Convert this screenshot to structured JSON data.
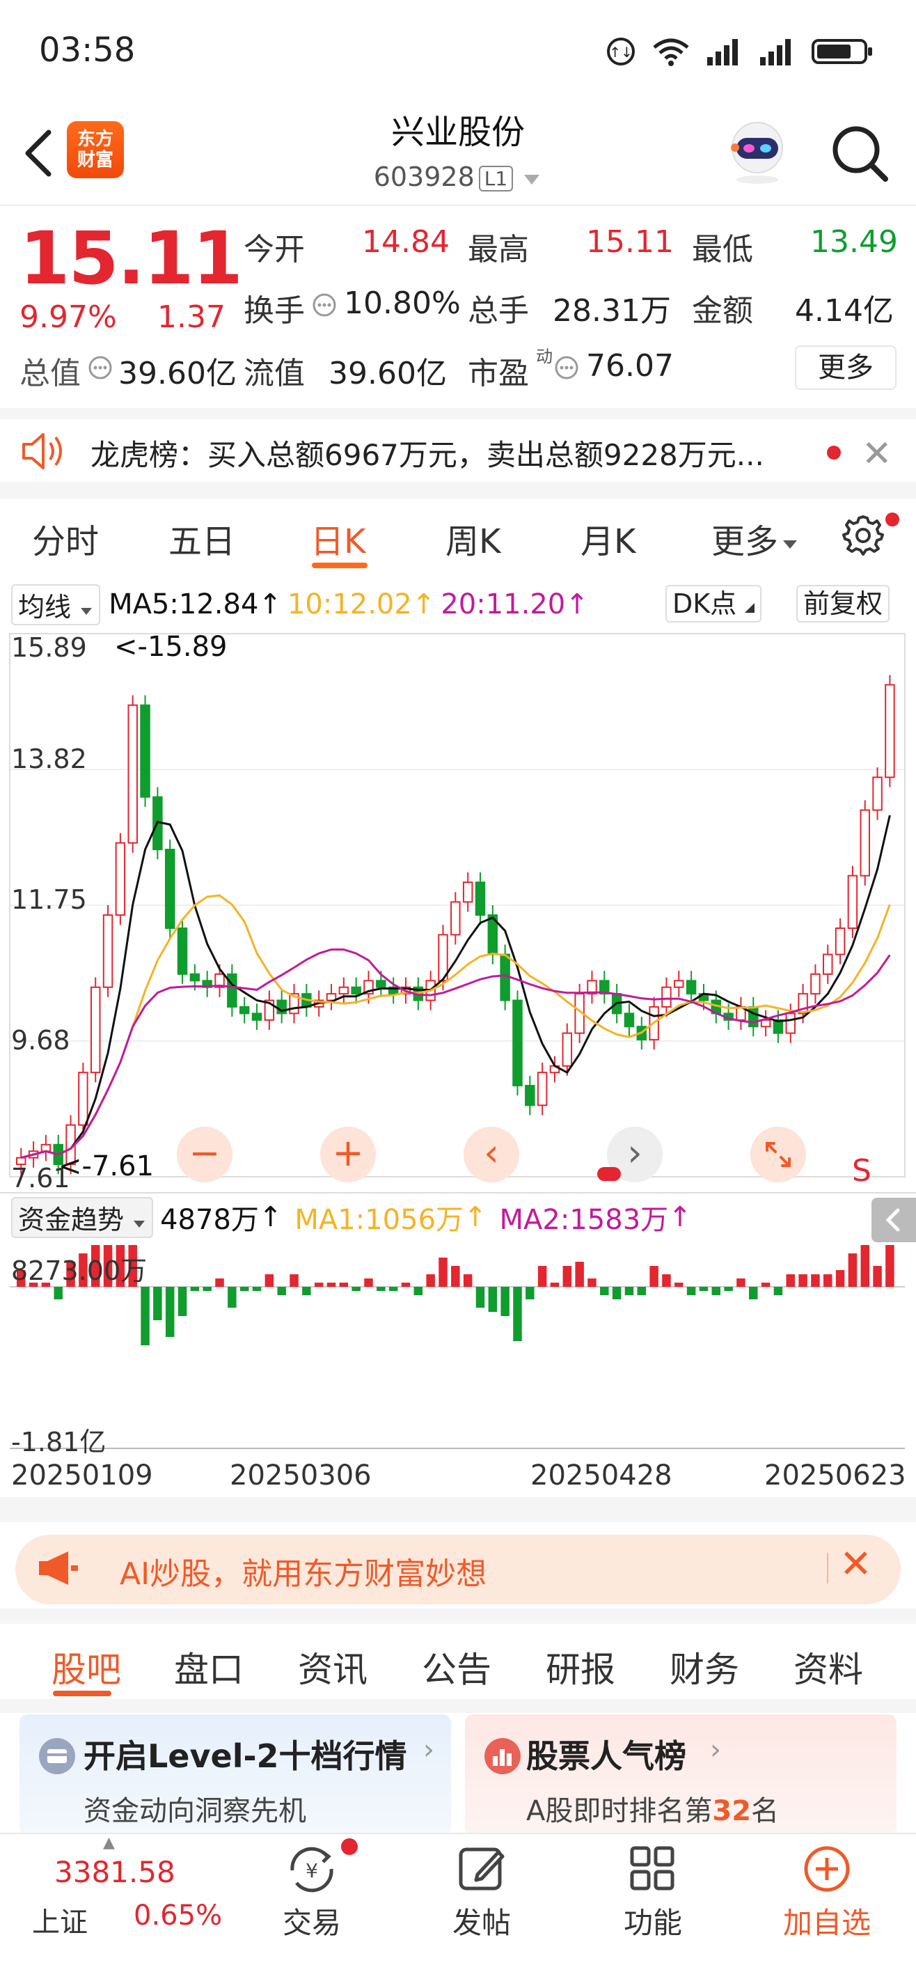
{
  "status_bar": {
    "time": "03:58"
  },
  "header": {
    "logo_line1": "东方",
    "logo_line2": "财富",
    "stock_name": "兴业股份",
    "stock_code": "603928",
    "level_badge": "L1"
  },
  "quote": {
    "price": "15.11",
    "change_pct": "9.97%",
    "change_amt": "1.37",
    "open_label": "今开",
    "open_value": "14.84",
    "high_label": "最高",
    "high_value": "15.11",
    "low_label": "最低",
    "low_value": "13.49",
    "turnover_label": "换手",
    "turnover_value": "10.80%",
    "volume_label": "总手",
    "volume_value": "28.31万",
    "amount_label": "金额",
    "amount_value": "4.14亿",
    "mktcap_label": "总值",
    "mktcap_value": "39.60亿",
    "float_label": "流值",
    "float_value": "39.60亿",
    "pe_label": "市盈",
    "pe_sup": "动",
    "pe_value": "76.07",
    "more_label": "更多"
  },
  "dragon_tiger": {
    "text": "龙虎榜：买入总额6967万元，卖出总额9228万元..."
  },
  "chart_tabs": [
    "分时",
    "五日",
    "日K",
    "周K",
    "月K",
    "更多"
  ],
  "chart_header": {
    "ma_selector": "均线",
    "ma5": "MA5:12.84",
    "ma10": "10:12.02",
    "ma20": "20:11.20",
    "dk_label": "DK点",
    "adjust_label": "前复权"
  },
  "chart_labels": {
    "y_ticks": [
      "15.89",
      "13.82",
      "11.75",
      "9.68",
      "7.61"
    ],
    "max_marker": "<-15.89",
    "min_marker": "<-7.61",
    "sell_marker": "S"
  },
  "fund_header": {
    "selector": "资金趋势",
    "value": "4878万",
    "ma1": "MA1:1056万",
    "ma2": "MA2:1583万",
    "y_top": "8273.00万",
    "y_bottom": "-1.81亿"
  },
  "x_axis": [
    "20250109",
    "20250306",
    "20250428",
    "20250623"
  ],
  "colors": {
    "up": "#e3262f",
    "down": "#0f9d2e",
    "accent": "#f05a28",
    "ma5": "#111111",
    "ma10": "#f5b324",
    "ma20": "#c21a9b"
  },
  "ai_banner": {
    "text": "AI炒股，就用东方财富妙想"
  },
  "bottom_tabs": [
    "股吧",
    "盘口",
    "资讯",
    "公告",
    "研报",
    "财务",
    "资料"
  ],
  "cards": {
    "left_title": "开启Level-2十档行情",
    "left_sub": "资金动向洞察先机",
    "right_title": "股票人气榜",
    "right_sub_prefix": "A股即时排名第",
    "right_rank": "32",
    "right_sub_suffix": "名"
  },
  "bottom_nav": {
    "index_value": "3381.58",
    "index_name": "上证",
    "index_change": "0.65%",
    "trade": "交易",
    "post": "发帖",
    "functions": "功能",
    "add_watch": "加自选"
  },
  "chart_data": {
    "type": "candlestick",
    "x_range": [
      "20250109",
      "20250627"
    ],
    "ylim": [
      7.61,
      15.89
    ],
    "approx_close": [
      7.9,
      8.0,
      8.1,
      7.8,
      8.4,
      9.2,
      10.5,
      11.6,
      12.7,
      14.8,
      13.4,
      12.6,
      11.4,
      10.7,
      10.6,
      10.5,
      10.7,
      10.2,
      10.1,
      10.0,
      10.3,
      10.1,
      10.4,
      10.2,
      10.3,
      10.4,
      10.5,
      10.4,
      10.6,
      10.5,
      10.4,
      10.5,
      10.3,
      10.6,
      11.3,
      11.8,
      12.1,
      11.6,
      11.0,
      10.3,
      9.0,
      8.7,
      9.2,
      9.3,
      9.8,
      10.4,
      10.6,
      10.4,
      10.1,
      9.9,
      9.7,
      10.2,
      10.5,
      10.6,
      10.4,
      10.3,
      10.1,
      10.0,
      10.2,
      9.9,
      10.0,
      9.8,
      10.1,
      10.4,
      10.7,
      11.0,
      11.4,
      12.2,
      13.2,
      13.7,
      15.11
    ],
    "ma5": "12.84",
    "ma10": "12.02",
    "ma20": "11.20"
  }
}
